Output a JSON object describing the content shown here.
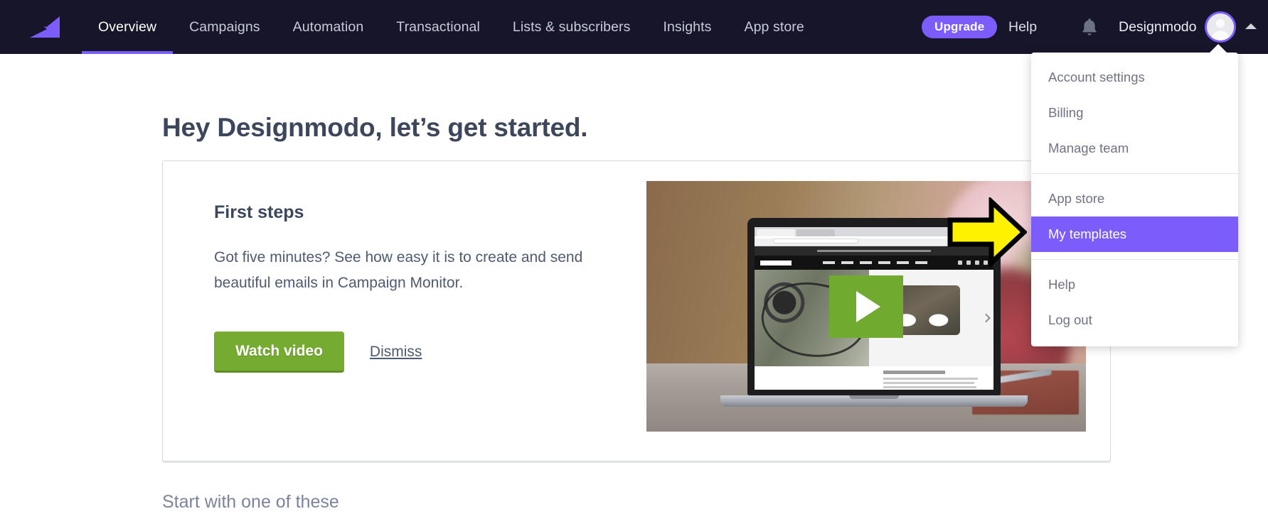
{
  "brand": {
    "logo_icon": "envelope-logo-icon",
    "accent_color": "#7c5cfa",
    "topbar_color": "#161529"
  },
  "topnav": {
    "items": [
      {
        "label": "Overview",
        "active": true
      },
      {
        "label": "Campaigns",
        "active": false
      },
      {
        "label": "Automation",
        "active": false
      },
      {
        "label": "Transactional",
        "active": false
      },
      {
        "label": "Lists & subscribers",
        "active": false
      },
      {
        "label": "Insights",
        "active": false
      },
      {
        "label": "App store",
        "active": false
      }
    ],
    "upgrade_label": "Upgrade",
    "help_label": "Help",
    "notifications_icon": "bell-icon",
    "account_name": "Designmodo",
    "avatar_icon": "user-avatar-icon",
    "caret_icon": "caret-up-icon"
  },
  "account_menu": {
    "groups": [
      {
        "items": [
          {
            "label": "Account settings",
            "selected": false
          },
          {
            "label": "Billing",
            "selected": false
          },
          {
            "label": "Manage team",
            "selected": false
          }
        ]
      },
      {
        "items": [
          {
            "label": "App store",
            "selected": false
          },
          {
            "label": "My templates",
            "selected": true
          }
        ]
      },
      {
        "items": [
          {
            "label": "Help",
            "selected": false
          },
          {
            "label": "Log out",
            "selected": false
          }
        ]
      }
    ],
    "highlight_color": "#7c5cfa"
  },
  "main": {
    "page_title": "Hey Designmodo, let’s get started.",
    "first_steps_card": {
      "heading": "First steps",
      "body": "Got five minutes? See how easy it is to create and send beautiful emails in Campaign Monitor.",
      "primary_button": "Watch video",
      "primary_button_color": "#75ab31",
      "secondary_link": "Dismiss",
      "video_thumbnail": {
        "alt": "Laptop on a desk showing the Converse website",
        "play_icon": "play-button-icon"
      }
    },
    "section_heading": "Start with one of these"
  },
  "annotation": {
    "arrow_icon": "yellow-right-arrow-icon",
    "fill": "#FFF200",
    "stroke": "#000000"
  }
}
